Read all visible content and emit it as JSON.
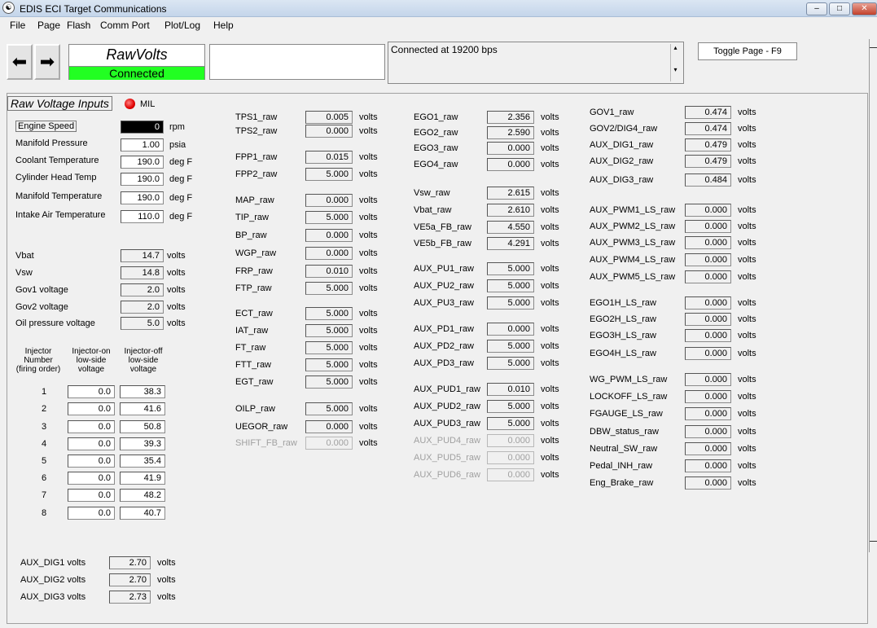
{
  "window": {
    "title": "EDIS ECI Target Communications",
    "controls": [
      "‒",
      "□",
      "✕"
    ]
  },
  "menu": {
    "file": "File",
    "page": "Page",
    "flash": "Flash",
    "comm_port": "Comm Port",
    "plot_log": "Plot/Log",
    "help": "Help"
  },
  "toolbar": {
    "page_name": "RawVolts",
    "connection_badge": "Connected",
    "status_text": "Connected at 19200 bps",
    "toggle_label": "Toggle Page - F9"
  },
  "section": {
    "title": "Raw Voltage Inputs",
    "mil_label": "MIL"
  },
  "col1_inputs": [
    {
      "label": "Engine Speed",
      "value": "0",
      "unit": "rpm"
    },
    {
      "label": "Manifold Pressure",
      "value": "1.00",
      "unit": "psia"
    },
    {
      "label": "Coolant Temperature",
      "value": "190.0",
      "unit": "deg F"
    },
    {
      "label": "Cylinder Head Temp",
      "value": "190.0",
      "unit": "deg F"
    },
    {
      "label": "Manifold Temperature",
      "value": "190.0",
      "unit": "deg F"
    },
    {
      "label": "Intake Air Temperature",
      "value": "110.0",
      "unit": "deg F"
    }
  ],
  "col1_volts": [
    {
      "label": "Vbat",
      "value": "14.7",
      "unit": "volts"
    },
    {
      "label": "Vsw",
      "value": "14.8",
      "unit": "volts"
    },
    {
      "label": "Gov1 voltage",
      "value": "2.0",
      "unit": "volts"
    },
    {
      "label": "Gov2 voltage",
      "value": "2.0",
      "unit": "volts"
    },
    {
      "label": "Oil pressure voltage",
      "value": "5.0",
      "unit": "volts"
    }
  ],
  "injectors": {
    "headers": {
      "number": "Injector\nNumber\n(firing order)",
      "on": "Injector-on\nlow-side\nvoltage",
      "off": "Injector-off\nlow-side\nvoltage"
    },
    "rows": [
      {
        "n": "1",
        "on": "0.0",
        "off": "38.3"
      },
      {
        "n": "2",
        "on": "0.0",
        "off": "41.6"
      },
      {
        "n": "3",
        "on": "0.0",
        "off": "50.8"
      },
      {
        "n": "4",
        "on": "0.0",
        "off": "39.3"
      },
      {
        "n": "5",
        "on": "0.0",
        "off": "35.4"
      },
      {
        "n": "6",
        "on": "0.0",
        "off": "41.9"
      },
      {
        "n": "7",
        "on": "0.0",
        "off": "48.2"
      },
      {
        "n": "8",
        "on": "0.0",
        "off": "40.7"
      }
    ]
  },
  "aux_dig_volts": [
    {
      "label": "AUX_DIG1 volts",
      "value": "2.70",
      "unit": "volts"
    },
    {
      "label": "AUX_DIG2 volts",
      "value": "2.70",
      "unit": "volts"
    },
    {
      "label": "AUX_DIG3 volts",
      "value": "2.73",
      "unit": "volts"
    }
  ],
  "col2": [
    {
      "label": "TPS1_raw",
      "value": "0.005",
      "unit": "volts"
    },
    {
      "label": "TPS2_raw",
      "value": "0.000",
      "unit": "volts"
    },
    {
      "label": "FPP1_raw",
      "value": "0.015",
      "unit": "volts"
    },
    {
      "label": "FPP2_raw",
      "value": "5.000",
      "unit": "volts"
    },
    {
      "label": "MAP_raw",
      "value": "0.000",
      "unit": "volts"
    },
    {
      "label": "TIP_raw",
      "value": "5.000",
      "unit": "volts"
    },
    {
      "label": "BP_raw",
      "value": "0.000",
      "unit": "volts"
    },
    {
      "label": "WGP_raw",
      "value": "0.000",
      "unit": "volts"
    },
    {
      "label": "FRP_raw",
      "value": "0.010",
      "unit": "volts"
    },
    {
      "label": "FTP_raw",
      "value": "5.000",
      "unit": "volts"
    },
    {
      "label": "ECT_raw",
      "value": "5.000",
      "unit": "volts"
    },
    {
      "label": "IAT_raw",
      "value": "5.000",
      "unit": "volts"
    },
    {
      "label": "FT_raw",
      "value": "5.000",
      "unit": "volts"
    },
    {
      "label": "FTT_raw",
      "value": "5.000",
      "unit": "volts"
    },
    {
      "label": "EGT_raw",
      "value": "5.000",
      "unit": "volts"
    },
    {
      "label": "OILP_raw",
      "value": "5.000",
      "unit": "volts"
    },
    {
      "label": "UEGOR_raw",
      "value": "0.000",
      "unit": "volts"
    },
    {
      "label": "SHIFT_FB_raw",
      "value": "0.000",
      "unit": "volts"
    }
  ],
  "col3": [
    {
      "label": "EGO1_raw",
      "value": "2.356",
      "unit": "volts"
    },
    {
      "label": "EGO2_raw",
      "value": "2.590",
      "unit": "volts"
    },
    {
      "label": "EGO3_raw",
      "value": "0.000",
      "unit": "volts"
    },
    {
      "label": "EGO4_raw",
      "value": "0.000",
      "unit": "volts"
    },
    {
      "label": "Vsw_raw",
      "value": "2.615",
      "unit": "volts"
    },
    {
      "label": "Vbat_raw",
      "value": "2.610",
      "unit": "volts"
    },
    {
      "label": "VE5a_FB_raw",
      "value": "4.550",
      "unit": "volts"
    },
    {
      "label": "VE5b_FB_raw",
      "value": "4.291",
      "unit": "volts"
    },
    {
      "label": "AUX_PU1_raw",
      "value": "5.000",
      "unit": "volts"
    },
    {
      "label": "AUX_PU2_raw",
      "value": "5.000",
      "unit": "volts"
    },
    {
      "label": "AUX_PU3_raw",
      "value": "5.000",
      "unit": "volts"
    },
    {
      "label": "AUX_PD1_raw",
      "value": "0.000",
      "unit": "volts"
    },
    {
      "label": "AUX_PD2_raw",
      "value": "5.000",
      "unit": "volts"
    },
    {
      "label": "AUX_PD3_raw",
      "value": "5.000",
      "unit": "volts"
    },
    {
      "label": "AUX_PUD1_raw",
      "value": "0.010",
      "unit": "volts"
    },
    {
      "label": "AUX_PUD2_raw",
      "value": "5.000",
      "unit": "volts"
    },
    {
      "label": "AUX_PUD3_raw",
      "value": "5.000",
      "unit": "volts"
    },
    {
      "label": "AUX_PUD4_raw",
      "value": "0.000",
      "unit": "volts"
    },
    {
      "label": "AUX_PUD5_raw",
      "value": "0.000",
      "unit": "volts"
    },
    {
      "label": "AUX_PUD6_raw",
      "value": "0.000",
      "unit": "volts"
    }
  ],
  "col4": [
    {
      "label": "GOV1_raw",
      "value": "0.474",
      "unit": "volts"
    },
    {
      "label": "GOV2/DIG4_raw",
      "value": "0.474",
      "unit": "volts"
    },
    {
      "label": "AUX_DIG1_raw",
      "value": "0.479",
      "unit": "volts"
    },
    {
      "label": "AUX_DIG2_raw",
      "value": "0.479",
      "unit": "volts"
    },
    {
      "label": "AUX_DIG3_raw",
      "value": "0.484",
      "unit": "volts"
    },
    {
      "label": "AUX_PWM1_LS_raw",
      "value": "0.000",
      "unit": "volts"
    },
    {
      "label": "AUX_PWM2_LS_raw",
      "value": "0.000",
      "unit": "volts"
    },
    {
      "label": "AUX_PWM3_LS_raw",
      "value": "0.000",
      "unit": "volts"
    },
    {
      "label": "AUX_PWM4_LS_raw",
      "value": "0.000",
      "unit": "volts"
    },
    {
      "label": "AUX_PWM5_LS_raw",
      "value": "0.000",
      "unit": "volts"
    },
    {
      "label": "EGO1H_LS_raw",
      "value": "0.000",
      "unit": "volts"
    },
    {
      "label": "EGO2H_LS_raw",
      "value": "0.000",
      "unit": "volts"
    },
    {
      "label": "EGO3H_LS_raw",
      "value": "0.000",
      "unit": "volts"
    },
    {
      "label": "EGO4H_LS_raw",
      "value": "0.000",
      "unit": "volts"
    },
    {
      "label": "WG_PWM_LS_raw",
      "value": "0.000",
      "unit": "volts"
    },
    {
      "label": "LOCKOFF_LS_raw",
      "value": "0.000",
      "unit": "volts"
    },
    {
      "label": "FGAUGE_LS_raw",
      "value": "0.000",
      "unit": "volts"
    },
    {
      "label": "DBW_status_raw",
      "value": "0.000",
      "unit": "volts"
    },
    {
      "label": "Neutral_SW_raw",
      "value": "0.000",
      "unit": "volts"
    },
    {
      "label": "Pedal_INH_raw",
      "value": "0.000",
      "unit": "volts"
    },
    {
      "label": "Eng_Brake_raw",
      "value": "0.000",
      "unit": "volts"
    }
  ],
  "colors": {
    "connected_green": "#22ff22",
    "mil_red": "#e00000",
    "titlebar": "#c4d5ea",
    "disabled_text": "#a0a0a0"
  }
}
